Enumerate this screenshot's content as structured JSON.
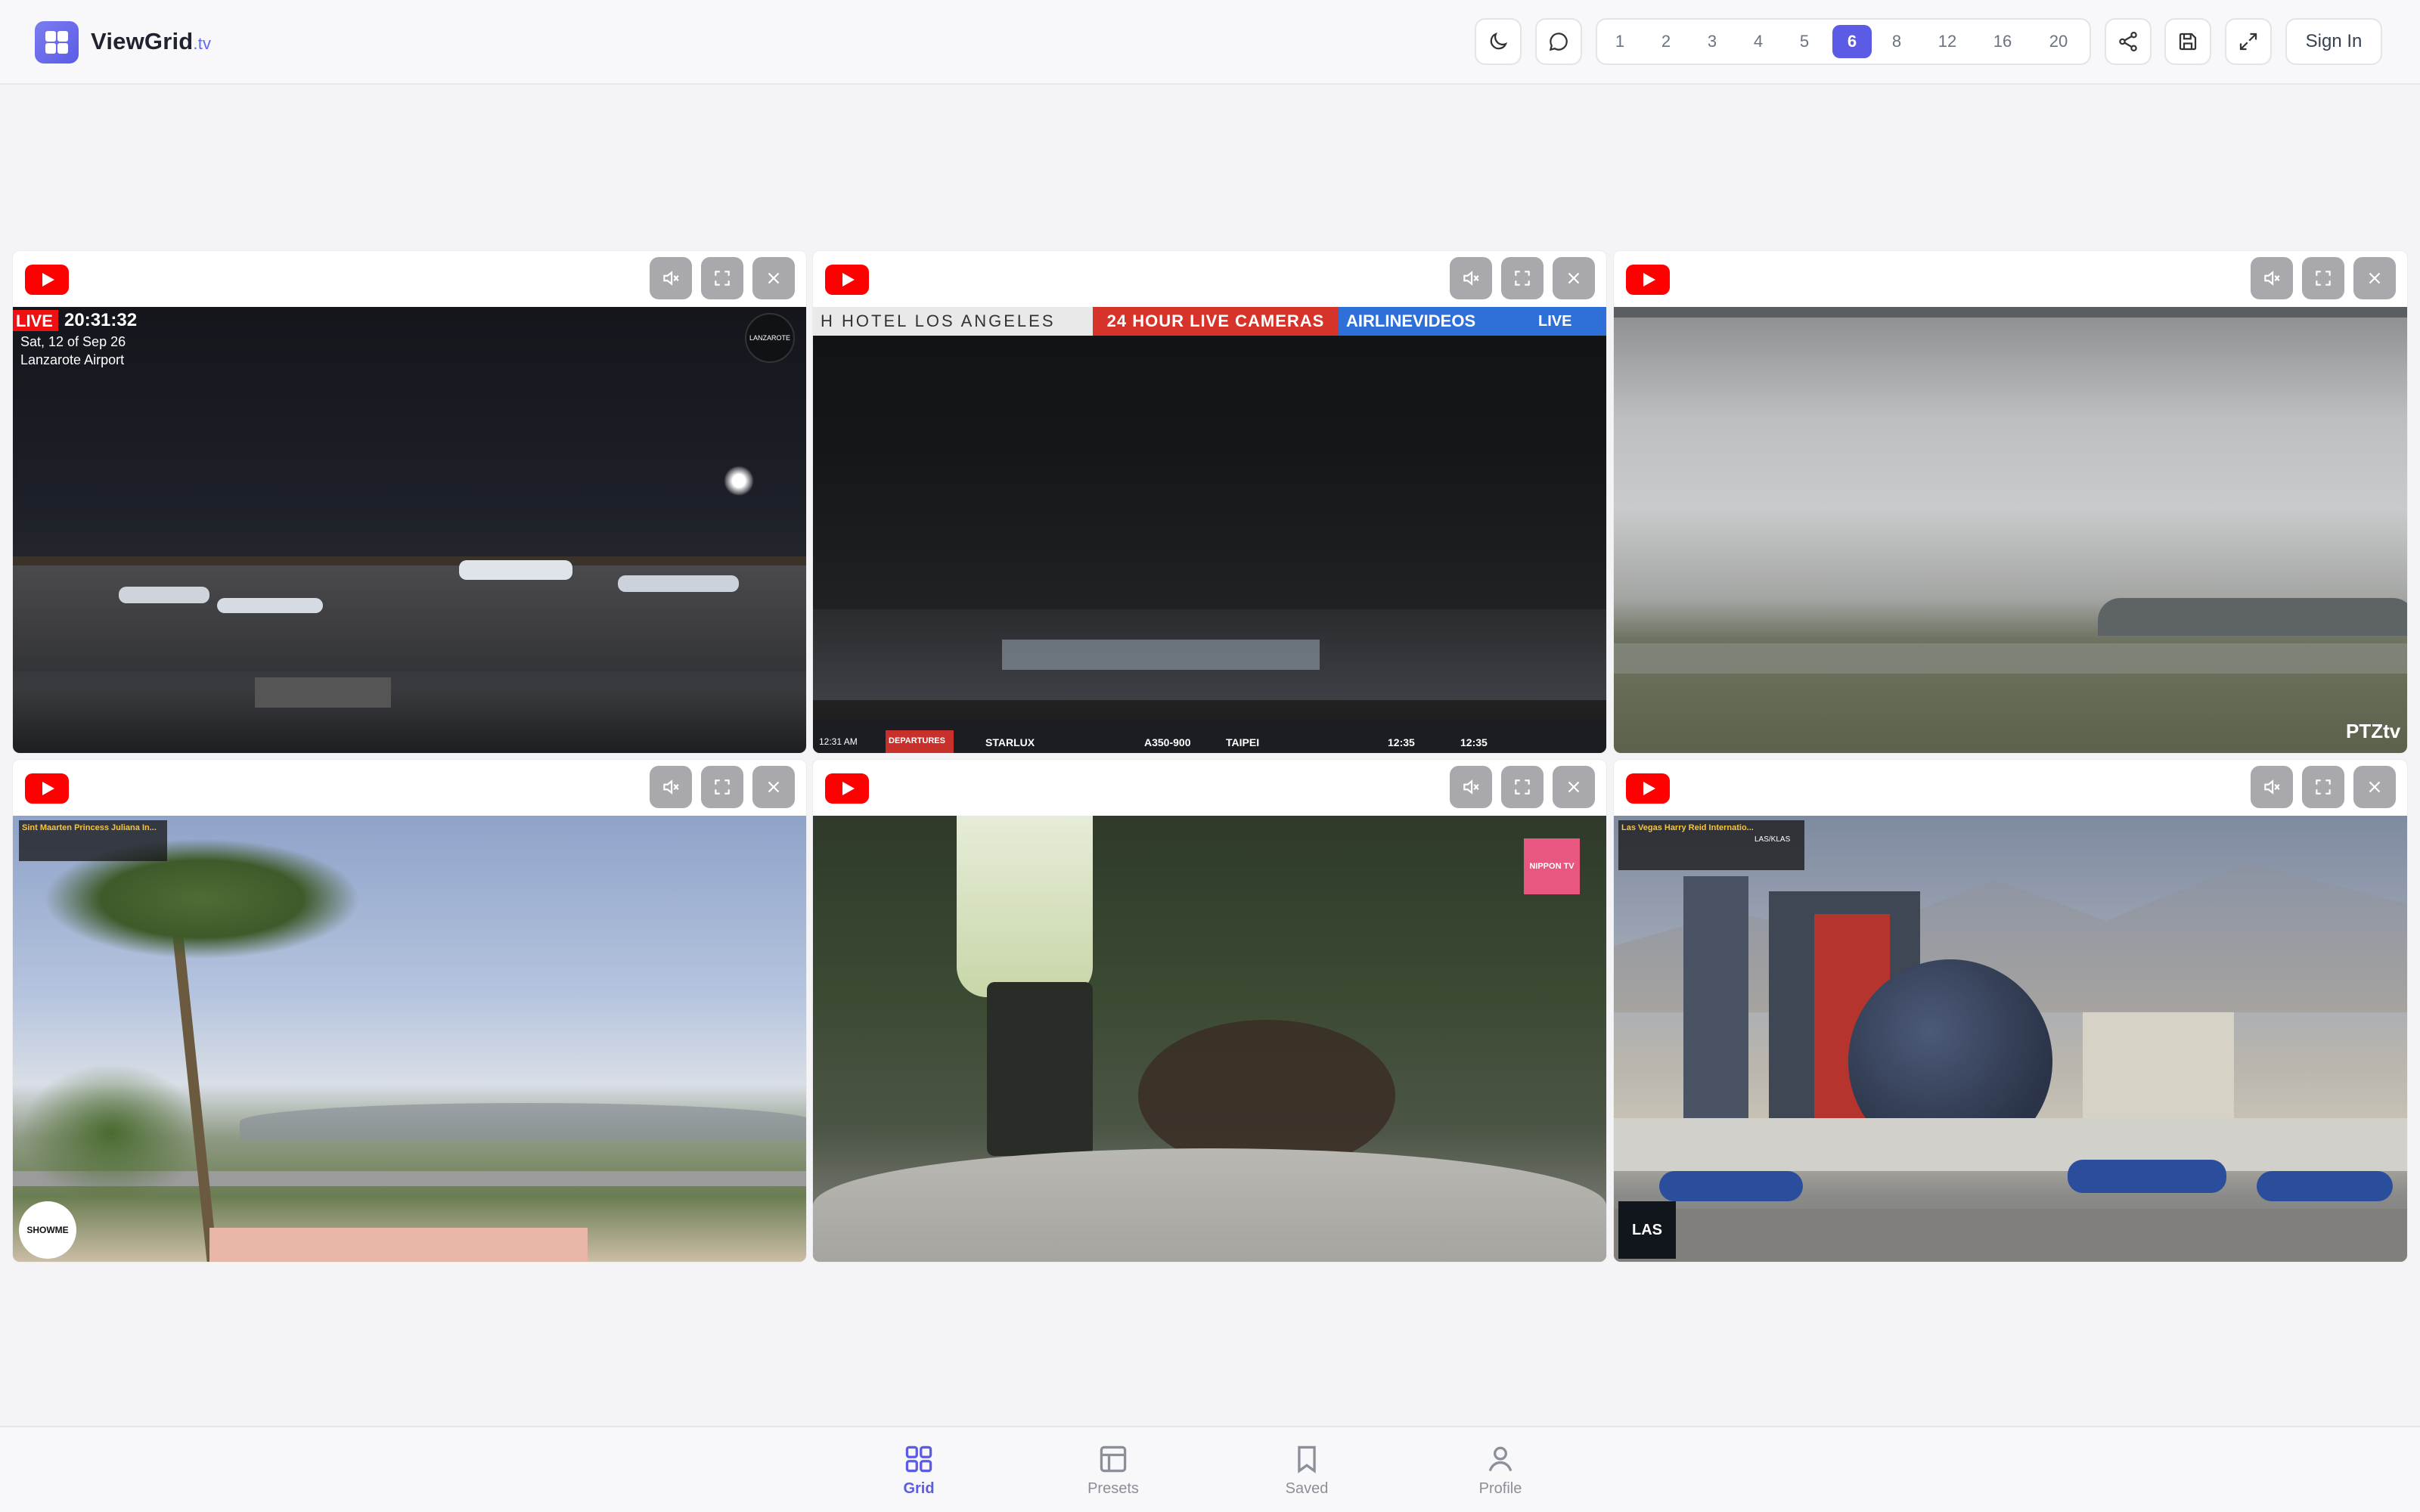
{
  "app": {
    "name": "ViewGrid",
    "tld": ".tv"
  },
  "header": {
    "grid_sizes": [
      "1",
      "2",
      "3",
      "4",
      "5",
      "6",
      "8",
      "12",
      "16",
      "20"
    ],
    "active_grid_size": "6",
    "sign_in": "Sign In"
  },
  "tiles": [
    {
      "source": "youtube",
      "overlay": {
        "live": "LIVE",
        "time": "20:31:32",
        "date": "Sat, 12 of Sep 26",
        "place": "Lanzarote Airport",
        "badge": "LANZAROTE"
      }
    },
    {
      "source": "youtube",
      "overlay": {
        "brand1": "H HOTEL LOS ANGELES",
        "brand2": "24 HOUR LIVE CAMERAS",
        "brand3": "AIRLINEVIDEOS",
        "live": "LIVE",
        "flight": "STARLUX",
        "aircraft": "A350-900",
        "dest": "TAIPEI",
        "sched": "12:35",
        "est": "12:35",
        "clock": "12:31 AM",
        "label_departures": "DEPARTURES"
      }
    },
    {
      "source": "youtube",
      "overlay": {
        "brand": "PTZtv"
      }
    },
    {
      "source": "youtube",
      "overlay": {
        "title": "Sint Maarten Princess Juliana In...",
        "brand": "SHOWME"
      }
    },
    {
      "source": "youtube",
      "overlay": {
        "brand": "NIPPON TV"
      }
    },
    {
      "source": "youtube",
      "overlay": {
        "title": "Las Vegas Harry Reid Internatio...",
        "code": "LAS/KLAS",
        "brand": "LAS"
      }
    }
  ],
  "bottom_nav": [
    {
      "label": "Grid",
      "icon": "grid-icon",
      "active": true
    },
    {
      "label": "Presets",
      "icon": "layout-icon",
      "active": false
    },
    {
      "label": "Saved",
      "icon": "bookmark-icon",
      "active": false
    },
    {
      "label": "Profile",
      "icon": "user-icon",
      "active": false
    }
  ],
  "colors": {
    "accent": "#5b5be6",
    "youtube": "#ff0000"
  }
}
